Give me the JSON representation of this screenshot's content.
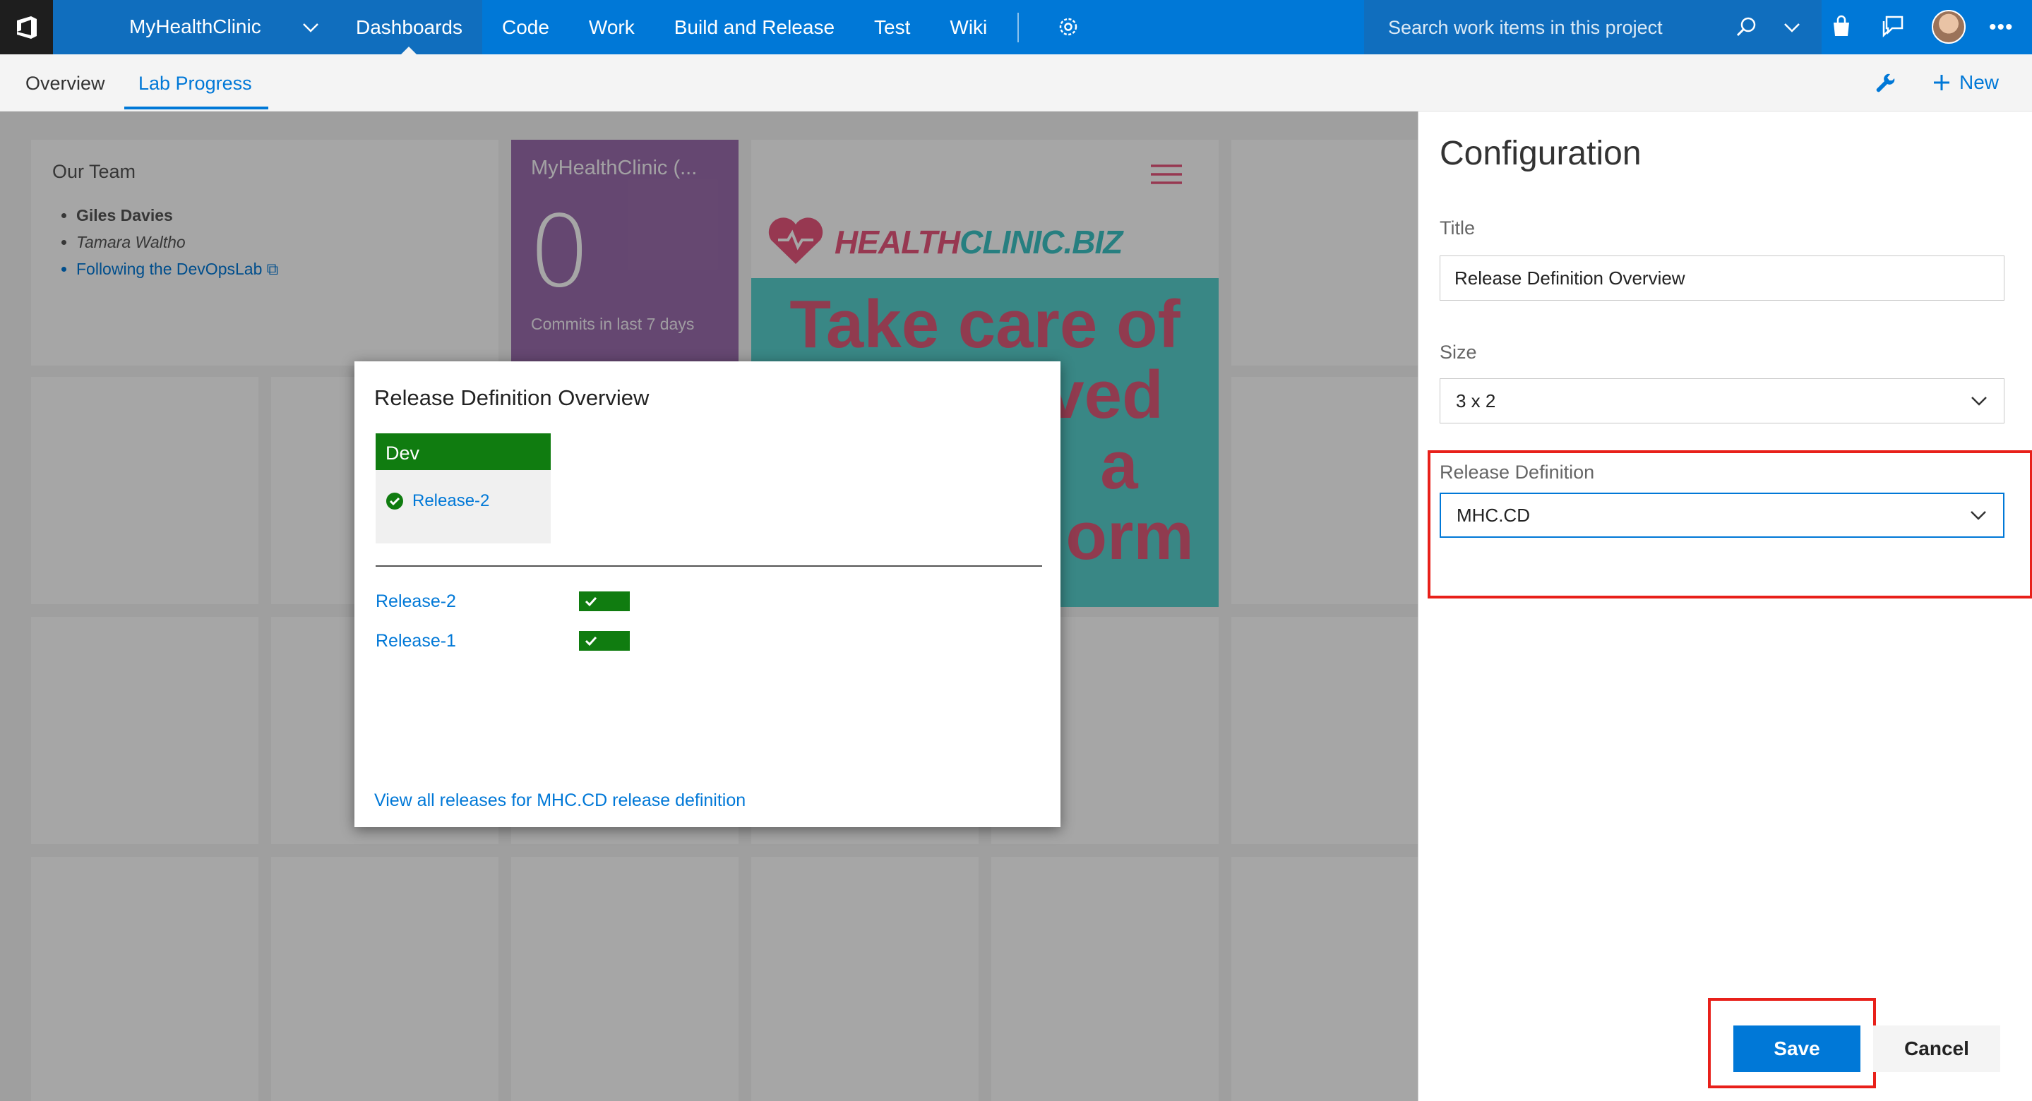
{
  "topbar": {
    "project": "MyHealthClinic",
    "nav": [
      "Dashboards",
      "Code",
      "Work",
      "Build and Release",
      "Test",
      "Wiki"
    ],
    "search_placeholder": "Search work items in this project"
  },
  "subnav": {
    "tabs": [
      "Overview",
      "Lab Progress"
    ],
    "new_label": "New"
  },
  "dashboard": {
    "team": {
      "title": "Our Team",
      "members": [
        "Giles Davies",
        "Tamara Waltho",
        "Following the DevOpsLab"
      ]
    },
    "commits": {
      "title": "MyHealthClinic (...",
      "count": "0",
      "subtitle": "Commits in last 7 days"
    },
    "healthclinic": {
      "logo_a": "HEALTH",
      "logo_b": "CLINIC.BIZ",
      "line1": "Take care of",
      "line2": "ved",
      "line3": "a",
      "line4": "orm"
    }
  },
  "preview": {
    "title": "Release Definition Overview",
    "environment": "Dev",
    "env_release": "Release-2",
    "releases": [
      "Release-2",
      "Release-1"
    ],
    "link": "View all releases for MHC.CD release definition"
  },
  "config": {
    "heading": "Configuration",
    "title_label": "Title",
    "title_value": "Release Definition Overview",
    "size_label": "Size",
    "size_value": "3 x 2",
    "release_label": "Release Definition",
    "release_value": "MHC.CD",
    "save_label": "Save",
    "cancel_label": "Cancel"
  },
  "colors": {
    "accent": "#0078d7",
    "success": "#107c10",
    "highlight": "#e8201a"
  }
}
